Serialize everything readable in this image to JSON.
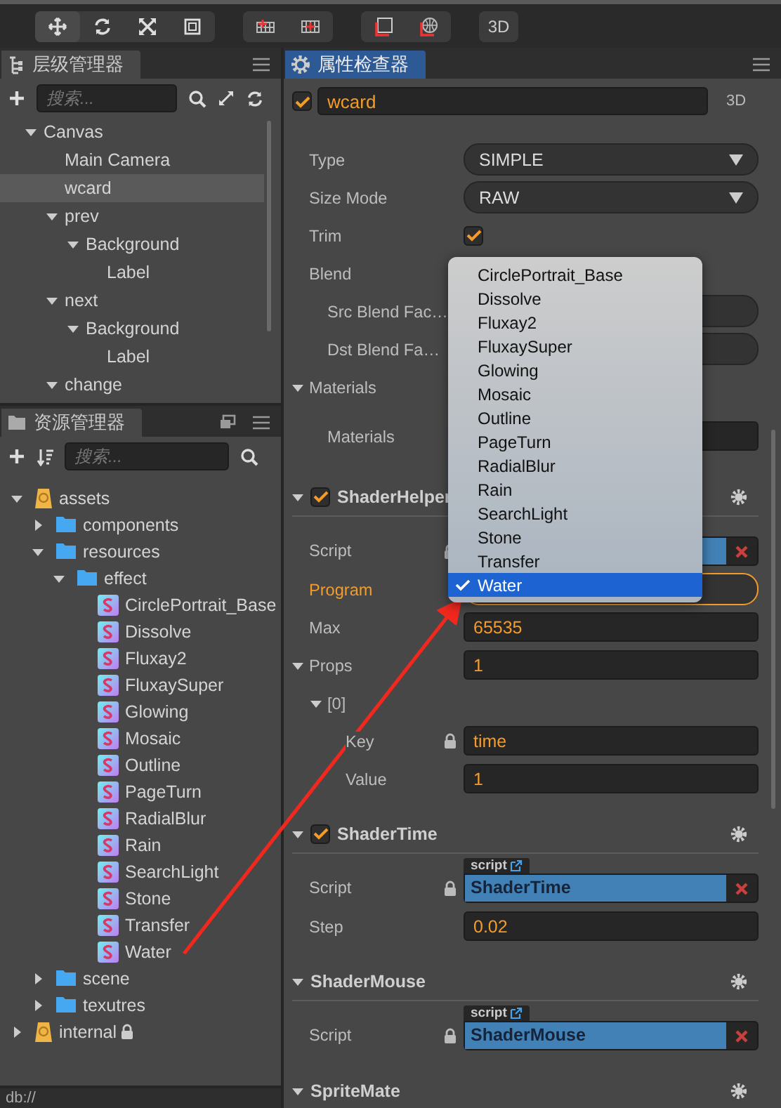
{
  "toolbar": {
    "view_button": "3D"
  },
  "hierarchy": {
    "title": "层级管理器",
    "search": {
      "placeholder": "搜索..."
    },
    "nodes": [
      {
        "label": "Canvas",
        "selected": false,
        "expanded": true,
        "children": [
          {
            "label": "Main Camera",
            "selected": false
          },
          {
            "label": "wcard",
            "selected": true
          },
          {
            "label": "prev",
            "selected": false,
            "expanded": true,
            "children": [
              {
                "label": "Background",
                "selected": false,
                "expanded": true,
                "children": [
                  {
                    "label": "Label",
                    "selected": false
                  }
                ]
              }
            ]
          },
          {
            "label": "next",
            "selected": false,
            "expanded": true,
            "children": [
              {
                "label": "Background",
                "selected": false,
                "expanded": true,
                "children": [
                  {
                    "label": "Label",
                    "selected": false
                  }
                ]
              }
            ]
          },
          {
            "label": "change",
            "selected": false,
            "expanded": true
          }
        ]
      }
    ]
  },
  "assets": {
    "title": "资源管理器",
    "search": {
      "placeholder": "搜索..."
    },
    "nodes": [
      {
        "label": "assets",
        "kind": "mount",
        "expanded": true,
        "children": [
          {
            "label": "components",
            "kind": "folder",
            "expanded": false
          },
          {
            "label": "resources",
            "kind": "folder",
            "expanded": true,
            "children": [
              {
                "label": "effect",
                "kind": "folder",
                "expanded": true,
                "children": [
                  {
                    "label": "CirclePortrait_Base",
                    "kind": "effect"
                  },
                  {
                    "label": "Dissolve",
                    "kind": "effect"
                  },
                  {
                    "label": "Fluxay2",
                    "kind": "effect"
                  },
                  {
                    "label": "FluxaySuper",
                    "kind": "effect"
                  },
                  {
                    "label": "Glowing",
                    "kind": "effect"
                  },
                  {
                    "label": "Mosaic",
                    "kind": "effect"
                  },
                  {
                    "label": "Outline",
                    "kind": "effect"
                  },
                  {
                    "label": "PageTurn",
                    "kind": "effect"
                  },
                  {
                    "label": "RadialBlur",
                    "kind": "effect"
                  },
                  {
                    "label": "Rain",
                    "kind": "effect"
                  },
                  {
                    "label": "SearchLight",
                    "kind": "effect"
                  },
                  {
                    "label": "Stone",
                    "kind": "effect"
                  },
                  {
                    "label": "Transfer",
                    "kind": "effect"
                  },
                  {
                    "label": "Water",
                    "kind": "effect"
                  }
                ]
              }
            ]
          },
          {
            "label": "scene",
            "kind": "folder",
            "expanded": false
          },
          {
            "label": "texutres",
            "kind": "folder",
            "expanded": false
          }
        ]
      },
      {
        "label": "internal",
        "kind": "mount",
        "expanded": false,
        "locked": true
      }
    ]
  },
  "inspector": {
    "title": "属性检查器",
    "node": {
      "enabled": true,
      "name": "wcard",
      "badge": "3D"
    },
    "rows": [
      {
        "kind": "select",
        "label": "Type",
        "value": "SIMPLE"
      },
      {
        "kind": "select",
        "label": "Size Mode",
        "value": "RAW"
      },
      {
        "kind": "checkbox",
        "label": "Trim",
        "checked": true
      },
      {
        "kind": "heading",
        "label": "Blend",
        "children": [
          {
            "kind": "select",
            "label": "Src Blend Fac…"
          },
          {
            "kind": "select",
            "label": "Dst Blend Fa…"
          }
        ]
      },
      {
        "kind": "group",
        "label": "Materials",
        "expanded": true,
        "children": [
          {
            "kind": "field",
            "label": "Materials"
          }
        ]
      }
    ],
    "components": [
      {
        "title": "ShaderHelper",
        "checked": true,
        "expanded": true,
        "rows": [
          {
            "kind": "asset",
            "label": "Script",
            "locked": true
          },
          {
            "kind": "select",
            "label": "Program",
            "highlighted": true
          },
          {
            "kind": "field",
            "label": "Max",
            "value": "65535"
          },
          {
            "kind": "group",
            "label": "Props",
            "value": "1",
            "expanded": true,
            "children": [
              {
                "kind": "group",
                "label": "[0]",
                "expanded": true,
                "children": [
                  {
                    "kind": "field",
                    "label": "Key",
                    "value": "time",
                    "locked": true
                  },
                  {
                    "kind": "field",
                    "label": "Value",
                    "value": "1"
                  }
                ]
              }
            ]
          }
        ]
      },
      {
        "title": "ShaderTime",
        "checked": true,
        "expanded": true,
        "rows": [
          {
            "kind": "asset",
            "label": "Script",
            "tag": "script",
            "value": "ShaderTime",
            "locked": true
          },
          {
            "kind": "field",
            "label": "Step",
            "value": "0.02"
          }
        ]
      },
      {
        "title": "ShaderMouse",
        "expanded": true,
        "rows": [
          {
            "kind": "asset",
            "label": "Script",
            "tag": "script",
            "value": "ShaderMouse",
            "locked": true
          }
        ]
      },
      {
        "title": "SpriteMate",
        "expanded": true
      }
    ],
    "dropdown": {
      "options": [
        {
          "label": "CirclePortrait_Base",
          "selected": false
        },
        {
          "label": "Dissolve",
          "selected": false
        },
        {
          "label": "Fluxay2",
          "selected": false
        },
        {
          "label": "FluxaySuper",
          "selected": false
        },
        {
          "label": "Glowing",
          "selected": false
        },
        {
          "label": "Mosaic",
          "selected": false
        },
        {
          "label": "Outline",
          "selected": false
        },
        {
          "label": "PageTurn",
          "selected": false
        },
        {
          "label": "RadialBlur",
          "selected": false
        },
        {
          "label": "Rain",
          "selected": false
        },
        {
          "label": "SearchLight",
          "selected": false
        },
        {
          "label": "Stone",
          "selected": false
        },
        {
          "label": "Transfer",
          "selected": false
        },
        {
          "label": "Water",
          "selected": true
        }
      ]
    }
  },
  "status_bar": {
    "path": "db://"
  }
}
